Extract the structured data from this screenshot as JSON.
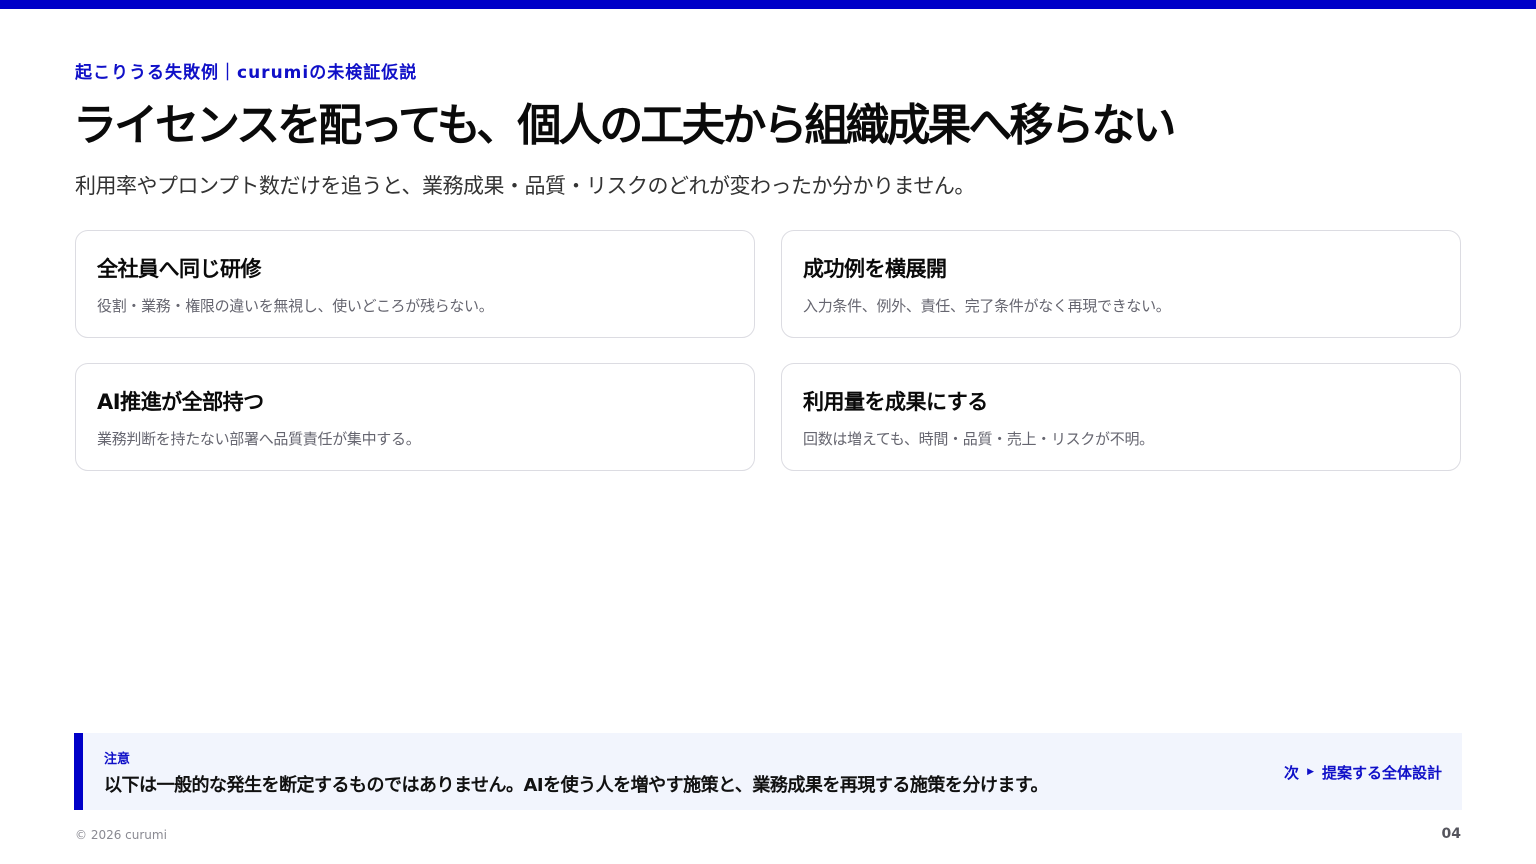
{
  "colors": {
    "accent": "#0000c8",
    "note_background": "#f2f5fd",
    "card_border": "#dcdce2"
  },
  "header": {
    "eyebrow": "起こりうる失敗例｜curumiの未検証仮説",
    "title": "ライセンスを配っても、個人の工夫から組織成果へ移らない",
    "subtitle": "利用率やプロンプト数だけを追うと、業務成果・品質・リスクのどれが変わったか分かりません。"
  },
  "cards": [
    {
      "title": "全社員へ同じ研修",
      "description": "役割・業務・権限の違いを無視し、使いどころが残らない。"
    },
    {
      "title": "成功例を横展開",
      "description": "入力条件、例外、責任、完了条件がなく再現できない。"
    },
    {
      "title": "AI推進が全部持つ",
      "description": "業務判断を持たない部署へ品質責任が集中する。"
    },
    {
      "title": "利用量を成果にする",
      "description": "回数は増えても、時間・品質・売上・リスクが不明。"
    }
  ],
  "note": {
    "label": "注意",
    "text": "以下は一般的な発生を断定するものではありません。AIを使う人を増やす施策と、業務成果を再現する施策を分けます。",
    "next_prefix": "次",
    "next_icon": "triangle-right-icon",
    "next_label": "提案する全体設計"
  },
  "footer": {
    "copyright": "© 2026 curumi",
    "page_number": "04"
  }
}
